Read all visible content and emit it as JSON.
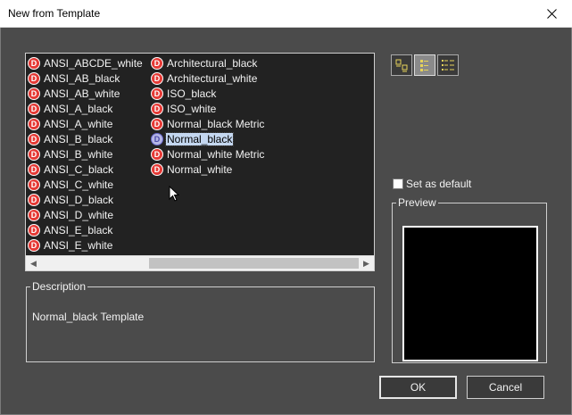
{
  "window": {
    "title": "New from Template"
  },
  "templates": {
    "column1": [
      "ANSI_ABCDE_white",
      "ANSI_AB_black",
      "ANSI_AB_white",
      "ANSI_A_black",
      "ANSI_A_white",
      "ANSI_B_black",
      "ANSI_B_white",
      "ANSI_C_black",
      "ANSI_C_white",
      "ANSI_D_black",
      "ANSI_D_white",
      "ANSI_E_black",
      "ANSI_E_white"
    ],
    "column2": [
      "Architectural_black",
      "Architectural_white",
      "ISO_black",
      "ISO_white",
      "Normal_black Metric",
      "Normal_black",
      "Normal_white Metric",
      "Normal_white"
    ],
    "selected": "Normal_black",
    "icon_letter": "D"
  },
  "set_default": {
    "label": "Set as default",
    "checked": false
  },
  "preview": {
    "legend": "Preview"
  },
  "description": {
    "legend": "Description",
    "text": "Normal_black Template"
  },
  "buttons": {
    "ok": "OK",
    "cancel": "Cancel"
  },
  "colors": {
    "background": "#4b4b4b",
    "list_bg": "#222222",
    "icon_red": "#e53935",
    "selection": "#c4d7f0"
  }
}
